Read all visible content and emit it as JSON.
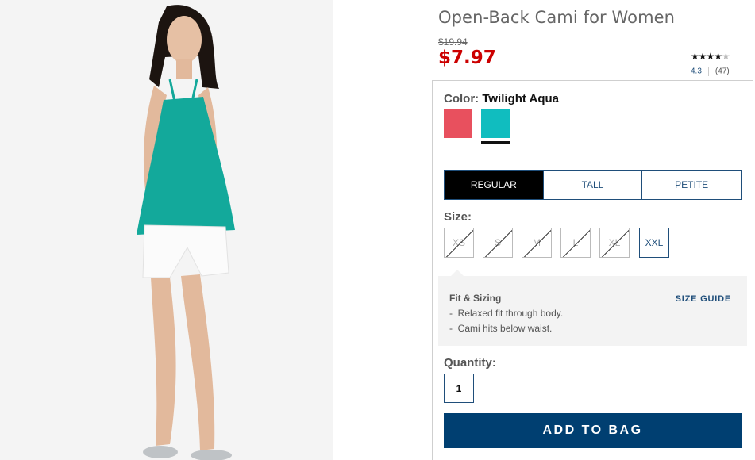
{
  "product": {
    "title": "Open-Back Cami for Women",
    "original_price": "$19.94",
    "sale_price": "$7.97",
    "rating_value": 4.3,
    "rating_text": "4.3",
    "review_count": "(47)"
  },
  "color": {
    "label": "Color:",
    "selected": "Twilight Aqua",
    "swatches": [
      {
        "name": "coral",
        "hex": "#e8505e"
      },
      {
        "name": "twilight-aqua",
        "hex": "#10bdbf"
      }
    ]
  },
  "fit_tabs": [
    "REGULAR",
    "TALL",
    "PETITE"
  ],
  "size": {
    "label": "Size:",
    "options": [
      {
        "label": "XS",
        "available": false
      },
      {
        "label": "S",
        "available": false
      },
      {
        "label": "M",
        "available": false
      },
      {
        "label": "L",
        "available": false
      },
      {
        "label": "XL",
        "available": false
      },
      {
        "label": "XXL",
        "available": true
      }
    ]
  },
  "fit_info": {
    "title": "Fit & Sizing",
    "lines": [
      "Relaxed fit through body.",
      "Cami hits below waist."
    ],
    "size_guide": "SIZE GUIDE"
  },
  "quantity": {
    "label": "Quantity:",
    "value": "1"
  },
  "cta": {
    "add_to_bag": "ADD TO BAG"
  },
  "colors": {
    "brand_navy": "#003f71",
    "sale_red": "#cc0000"
  }
}
